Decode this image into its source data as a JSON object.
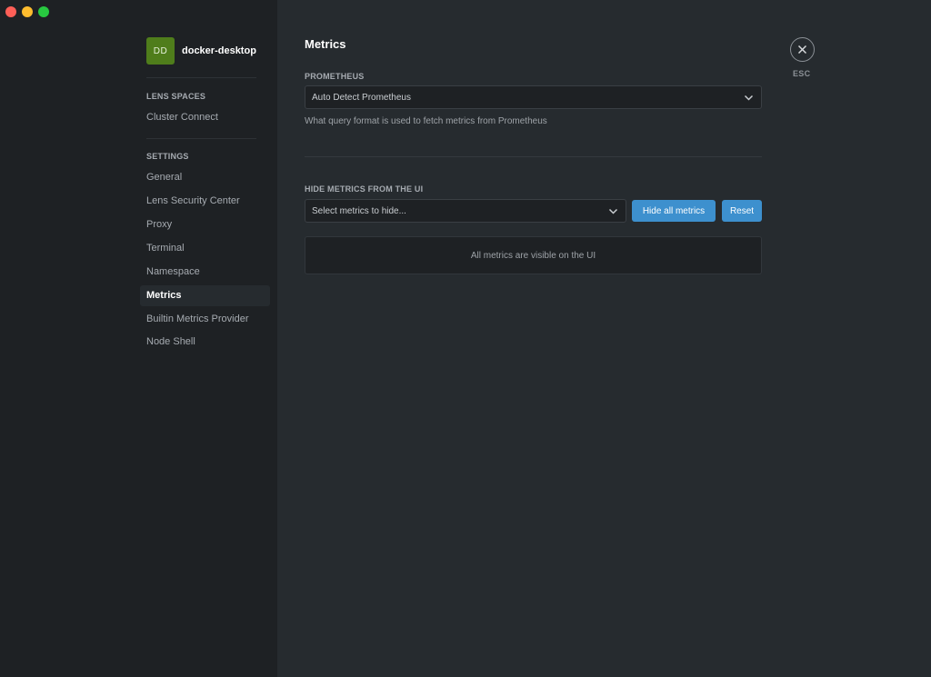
{
  "cluster": {
    "initials": "DD",
    "name": "docker-desktop",
    "avatar_color": "#4f7d1b"
  },
  "sidebar": {
    "lens_spaces": {
      "title": "LENS SPACES",
      "items": [
        {
          "label": "Cluster Connect"
        }
      ]
    },
    "settings": {
      "title": "SETTINGS",
      "items": [
        {
          "label": "General"
        },
        {
          "label": "Lens Security Center"
        },
        {
          "label": "Proxy"
        },
        {
          "label": "Terminal"
        },
        {
          "label": "Namespace"
        },
        {
          "label": "Metrics",
          "active": true
        },
        {
          "label": "Builtin Metrics Provider"
        },
        {
          "label": "Node Shell"
        }
      ]
    }
  },
  "main": {
    "title": "Metrics",
    "prometheus": {
      "label": "PROMETHEUS",
      "selected": "Auto Detect Prometheus",
      "hint": "What query format is used to fetch metrics from Prometheus"
    },
    "hide_metrics": {
      "label": "HIDE METRICS FROM THE UI",
      "placeholder": "Select metrics to hide...",
      "hide_all_label": "Hide all metrics",
      "reset_label": "Reset",
      "empty_message": "All metrics are visible on the UI"
    }
  },
  "close": {
    "label": "ESC",
    "icon": "close-icon"
  },
  "colors": {
    "accent": "#3d90ce",
    "sidebar_bg": "#1e2124",
    "main_bg": "#262b2f"
  }
}
